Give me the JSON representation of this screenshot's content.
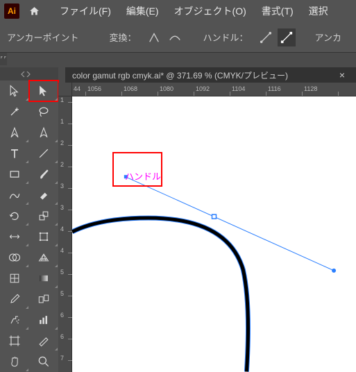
{
  "app": {
    "abbrev": "Ai"
  },
  "menu": {
    "file": "ファイル(F)",
    "edit": "編集(E)",
    "object": "オブジェクト(O)",
    "type": "書式(T)",
    "select": "選択"
  },
  "controlbar": {
    "left_label": "アンカーポイント",
    "convert_label": "変換：",
    "handle_label": "ハンドル：",
    "right_label": "アンカ"
  },
  "tab": {
    "title": "color gamut rgb cmyk.ai* @ 371.69 % (CMYK/プレビュー)",
    "close": "×"
  },
  "ruler": {
    "h_ticks": [
      "44",
      "1056",
      "1068",
      "1080",
      "1092",
      "1104",
      "1116",
      "1128"
    ],
    "v_ticks": [
      "1",
      "1",
      "2",
      "2",
      "3",
      "3",
      "4",
      "4",
      "5",
      "5",
      "6",
      "6",
      "7"
    ]
  },
  "annotation": {
    "label": "ハンドル"
  },
  "colors": {
    "accent": "#ff9a00",
    "anchor": "#0066ff",
    "ann_border": "#ff0000",
    "ann_text": "#ff00ff"
  }
}
